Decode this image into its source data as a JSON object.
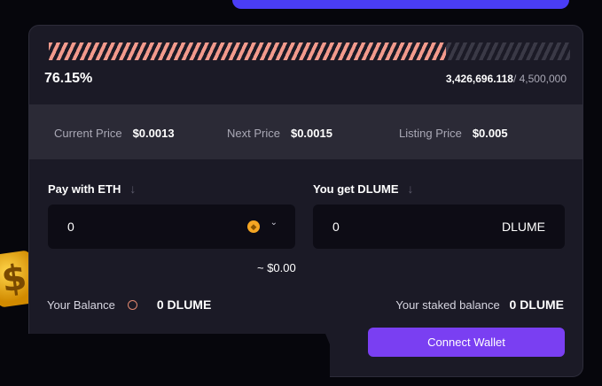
{
  "presale": {
    "progress_fraction": 0.7615,
    "percent_label": "76.15%",
    "sold_amount": "3,426,696.118",
    "total_label": "/ 4,500,000"
  },
  "prices": {
    "current_label": "Current Price",
    "current_value": "$0.0013",
    "next_label": "Next Price",
    "next_value": "$0.0015",
    "listing_label": "Listing Price",
    "listing_value": "$0.005"
  },
  "pay": {
    "label": "Pay with ETH",
    "arrow_icon": "arrow-down-icon",
    "value": "0",
    "coin_icon": "eth-coin-icon",
    "dropdown_icon": "chevron-down-icon"
  },
  "receive": {
    "label": "You get DLUME",
    "arrow_icon": "arrow-down-icon",
    "value": "0",
    "token": "DLUME"
  },
  "usd_estimate": "~ $0.00",
  "balance": {
    "label": "Your Balance",
    "info_icon": "info-icon",
    "value": "0 DLUME"
  },
  "staked": {
    "label": "Your staked balance",
    "value": "0 DLUME"
  },
  "connect_label": "Connect Wallet",
  "colors": {
    "accent": "#7a3ff2",
    "progress": "#f29a8c",
    "top_button": "#4a3df5",
    "panel": "#1b1a26"
  }
}
